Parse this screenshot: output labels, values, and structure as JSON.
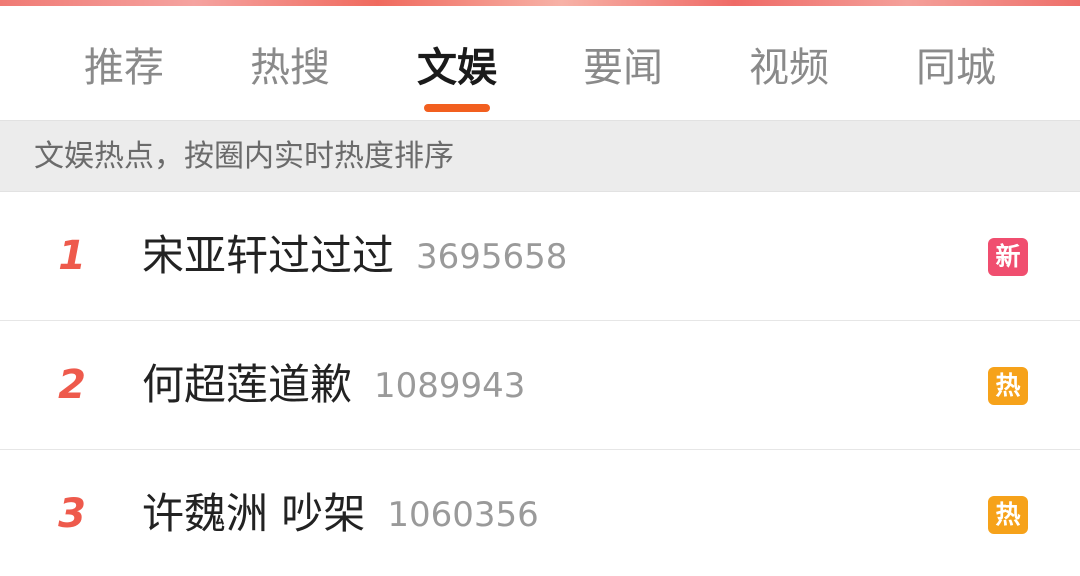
{
  "tabs": [
    {
      "label": "推荐",
      "active": false
    },
    {
      "label": "热搜",
      "active": false
    },
    {
      "label": "文娱",
      "active": true
    },
    {
      "label": "要闻",
      "active": false
    },
    {
      "label": "视频",
      "active": false
    },
    {
      "label": "同城",
      "active": false
    }
  ],
  "subheader": {
    "text": "文娱热点，按圈内实时热度排序"
  },
  "colors": {
    "accent": "#f25f1f",
    "rank": "#ee5a4c",
    "badge_new": "#f04e6f",
    "badge_hot": "#f6a21a"
  },
  "items": [
    {
      "rank": "1",
      "title": "宋亚轩过过过",
      "count": "3695658",
      "badge": "新",
      "badge_type": "new"
    },
    {
      "rank": "2",
      "title": "何超莲道歉",
      "count": "1089943",
      "badge": "热",
      "badge_type": "hot"
    },
    {
      "rank": "3",
      "title": "许魏洲 吵架",
      "count": "1060356",
      "badge": "热",
      "badge_type": "hot"
    }
  ]
}
